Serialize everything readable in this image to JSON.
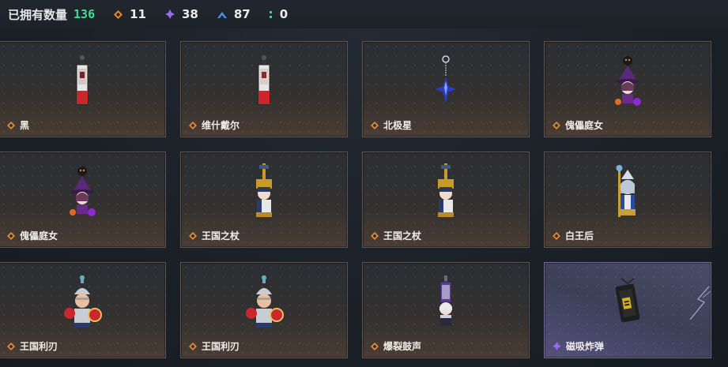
{
  "header": {
    "owned_label": "已拥有数量",
    "owned_count": "136",
    "stats": [
      {
        "icon": "orange-diamond-icon",
        "value": "11",
        "color": "#e08a3c"
      },
      {
        "icon": "purple-diamond-icon",
        "value": "38",
        "color": "#9a6cf0"
      },
      {
        "icon": "blue-chevron-icon",
        "value": "87",
        "color": "#4a8fe0"
      },
      {
        "icon": "green-dots-icon",
        "value": "0",
        "color": "#3fd08a"
      }
    ]
  },
  "items": [
    {
      "name": "黑",
      "rarity": "orange",
      "figure": "banner-red"
    },
    {
      "name": "维什戴尔",
      "rarity": "orange",
      "figure": "banner-red"
    },
    {
      "name": "北极星",
      "rarity": "orange",
      "figure": "blue-star"
    },
    {
      "name": "傀儡庭女",
      "rarity": "orange",
      "figure": "witch"
    },
    {
      "name": "傀儡庭女",
      "rarity": "orange",
      "figure": "witch"
    },
    {
      "name": "王国之杖",
      "rarity": "orange",
      "figure": "king"
    },
    {
      "name": "王国之杖",
      "rarity": "orange",
      "figure": "king"
    },
    {
      "name": "白王后",
      "rarity": "orange",
      "figure": "queen"
    },
    {
      "name": "王国利刃",
      "rarity": "orange",
      "figure": "knight"
    },
    {
      "name": "王国利刃",
      "rarity": "orange",
      "figure": "knight"
    },
    {
      "name": "爆裂鼓声",
      "rarity": "orange",
      "figure": "drummer"
    },
    {
      "name": "磁吸炸弹",
      "rarity": "purple",
      "figure": "bomb"
    }
  ]
}
